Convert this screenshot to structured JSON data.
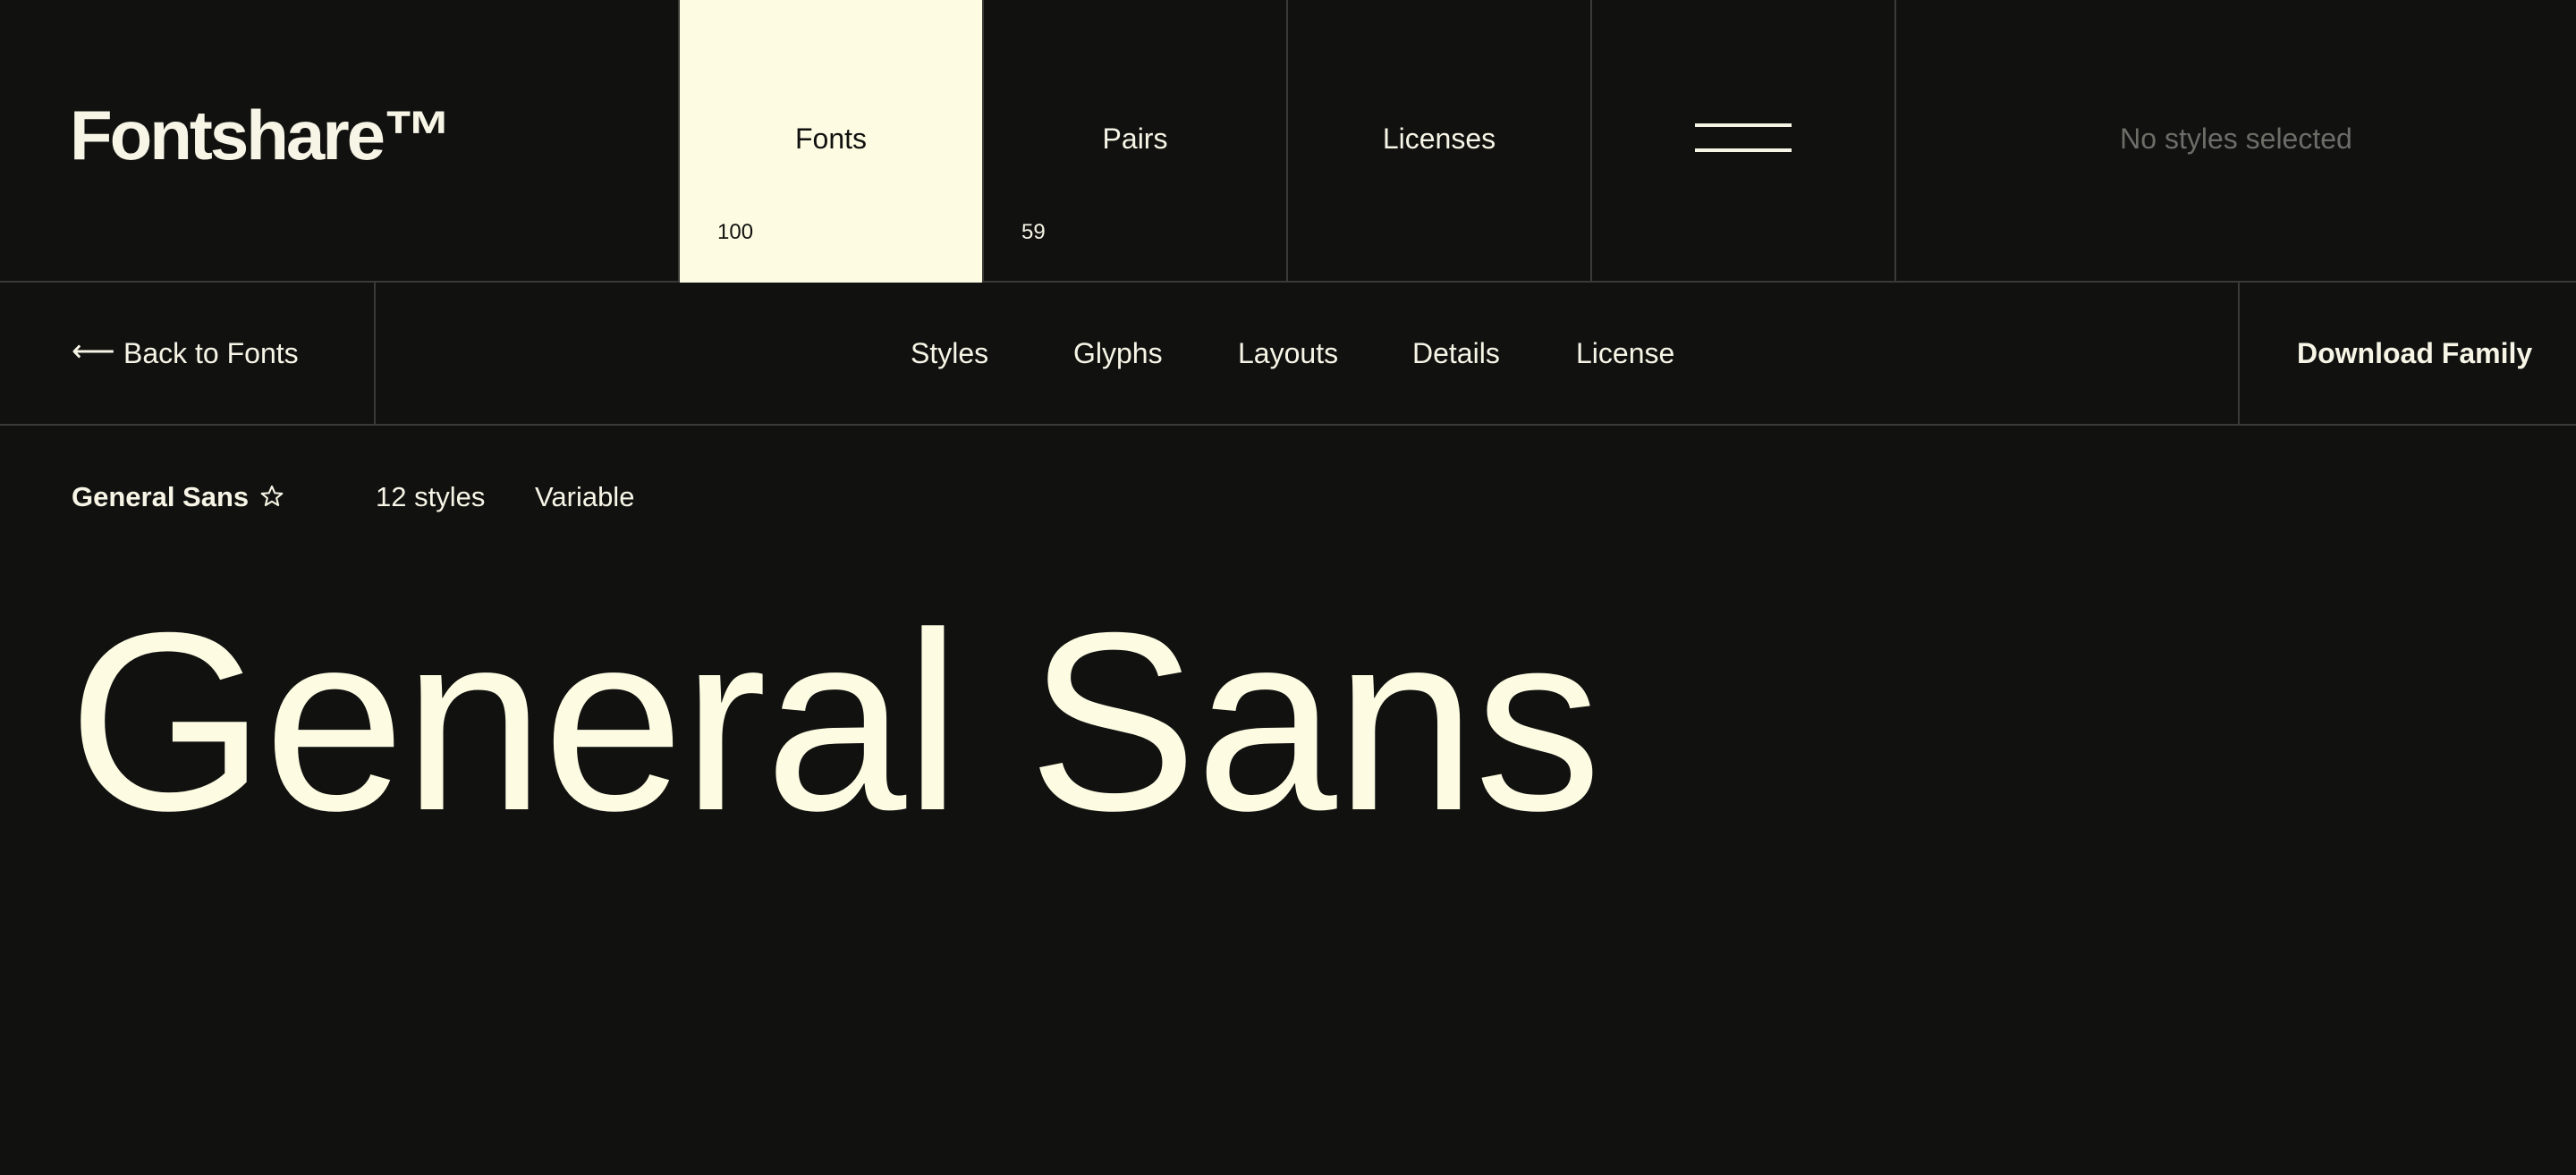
{
  "brand": {
    "logo": "Fontshare™"
  },
  "nav": {
    "fonts": {
      "label": "Fonts",
      "count": "100"
    },
    "pairs": {
      "label": "Pairs",
      "count": "59"
    },
    "licenses": {
      "label": "Licenses"
    },
    "menu_icon": "hamburger-menu-icon",
    "selection_status": "No styles selected"
  },
  "subnav": {
    "back_arrow": "⟵",
    "back_label": "Back to Fonts",
    "tabs": [
      "Styles",
      "Glyphs",
      "Layouts",
      "Details",
      "License"
    ],
    "download_label": "Download Family"
  },
  "font": {
    "name": "General Sans",
    "styles_count": "12 styles",
    "variable_label": "Variable",
    "preview_text": "General Sans"
  },
  "colors": {
    "background": "#111110",
    "foreground": "#f7f5e6",
    "active_tab": "#fdfce3",
    "muted": "#6d6d68",
    "divider": "#3a3a38"
  }
}
